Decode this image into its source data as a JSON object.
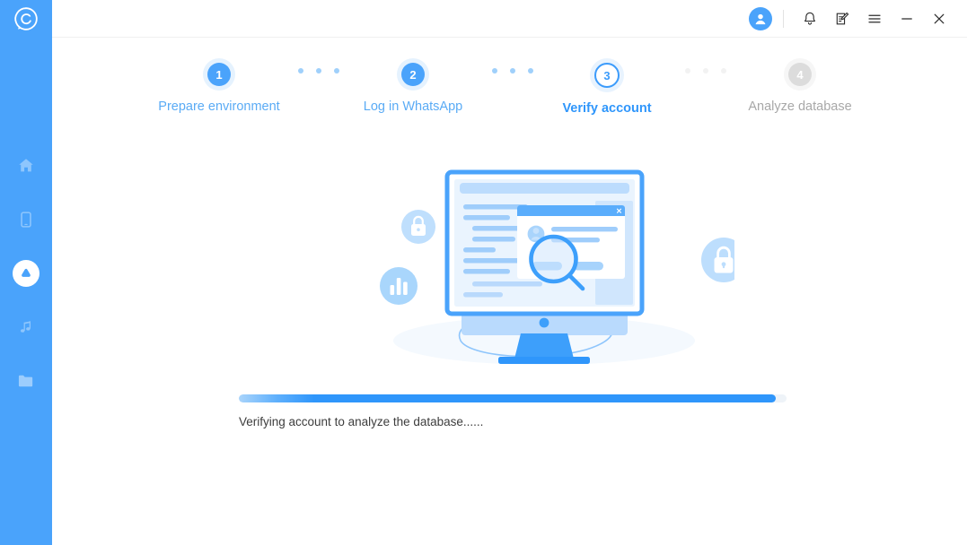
{
  "app": {
    "logo_icon": "whatsapp-recovery-logo-icon",
    "accent_color": "#4aa3fb",
    "sidebar_color": "#4aa3fb"
  },
  "sidebar": {
    "items": [
      {
        "icon": "home-icon",
        "name": "home",
        "active": false
      },
      {
        "icon": "phone-icon",
        "name": "device",
        "active": false
      },
      {
        "icon": "droplet-icon",
        "name": "recover",
        "active": true
      },
      {
        "icon": "music-icon",
        "name": "music",
        "active": false
      },
      {
        "icon": "folder-icon",
        "name": "files",
        "active": false
      }
    ]
  },
  "titlebar": {
    "avatar_icon": "user-avatar-icon",
    "buttons": [
      {
        "icon": "bell-icon",
        "name": "notifications"
      },
      {
        "icon": "feedback-icon",
        "name": "feedback"
      },
      {
        "icon": "menu-icon",
        "name": "menu"
      },
      {
        "icon": "minimize-icon",
        "name": "minimize"
      },
      {
        "icon": "close-icon",
        "name": "close"
      }
    ]
  },
  "stepper": {
    "steps": [
      {
        "number": "1",
        "label": "Prepare environment",
        "state": "done"
      },
      {
        "number": "2",
        "label": "Log in WhatsApp",
        "state": "done"
      },
      {
        "number": "3",
        "label": "Verify account",
        "state": "active"
      },
      {
        "number": "4",
        "label": "Analyze database",
        "state": "todo"
      }
    ]
  },
  "illustration": {
    "name": "database-verification-illustration",
    "badges": [
      {
        "icon": "lock-icon",
        "name": "lock-badge-small"
      },
      {
        "icon": "bar-chart-icon",
        "name": "chart-badge"
      },
      {
        "icon": "lock-icon",
        "name": "lock-badge-large"
      }
    ],
    "screen_icon": "magnifier-icon"
  },
  "progress": {
    "percent": 98,
    "status_text": "Verifying account to analyze the database......",
    "fill_color": "#2f96fb",
    "track_color": "#eef3f8"
  }
}
